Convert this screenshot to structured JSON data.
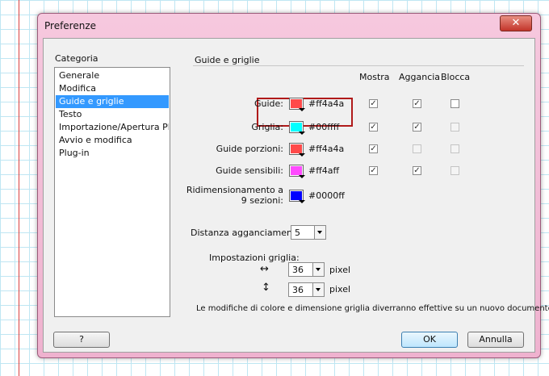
{
  "window": {
    "title": "Preferenze",
    "close_glyph": "✕"
  },
  "category": {
    "label": "Categoria",
    "items": [
      "Generale",
      "Modifica",
      "Guide e griglie",
      "Testo",
      "Importazione/Apertura Ph...",
      "Avvio e modifica",
      "Plug-in"
    ],
    "selected": "Guide e griglie"
  },
  "section": {
    "title": "Guide e griglie",
    "col_headers": {
      "show": "Mostra",
      "snap": "Aggancia",
      "lock": "Blocca"
    },
    "rows": [
      {
        "label": "Guide:",
        "color": "#ff4a4a",
        "hex": "#ff4a4a",
        "show": true,
        "snap": true,
        "lock": false,
        "lock_enabled": true
      },
      {
        "label": "Griglia:",
        "color": "#00ffff",
        "hex": "#00ffff",
        "show": true,
        "snap": true,
        "lock": false,
        "lock_enabled": false
      },
      {
        "label": "Guide porzioni:",
        "color": "#ff4a4a",
        "hex": "#ff4a4a",
        "show": true,
        "snap": false,
        "lock": false,
        "lock_enabled": false,
        "snap_enabled": false
      },
      {
        "label": "Guide sensibili:",
        "color": "#ff4aff",
        "hex": "#ff4aff",
        "show": true,
        "snap": true,
        "lock": false,
        "lock_enabled": false
      }
    ],
    "scale9": {
      "label_line1": "Ridimensionamento a",
      "label_line2": "9 sezioni:",
      "color": "#0000ff",
      "hex": "#0000ff"
    }
  },
  "snap_distance": {
    "label": "Distanza agganciamento:",
    "value": "5"
  },
  "grid_settings": {
    "label": "Impostazioni griglia:",
    "horizontal_glyph": "↔",
    "vertical_glyph": "↕",
    "width": "36",
    "height": "36",
    "unit": "pixel"
  },
  "note": "Le modifiche di colore e dimensione griglia diverranno effettive su un nuovo documento.",
  "buttons": {
    "help": "?",
    "ok": "OK",
    "cancel": "Annulla"
  },
  "accent": "#3399ff",
  "highlight_color": "#b01a1a"
}
